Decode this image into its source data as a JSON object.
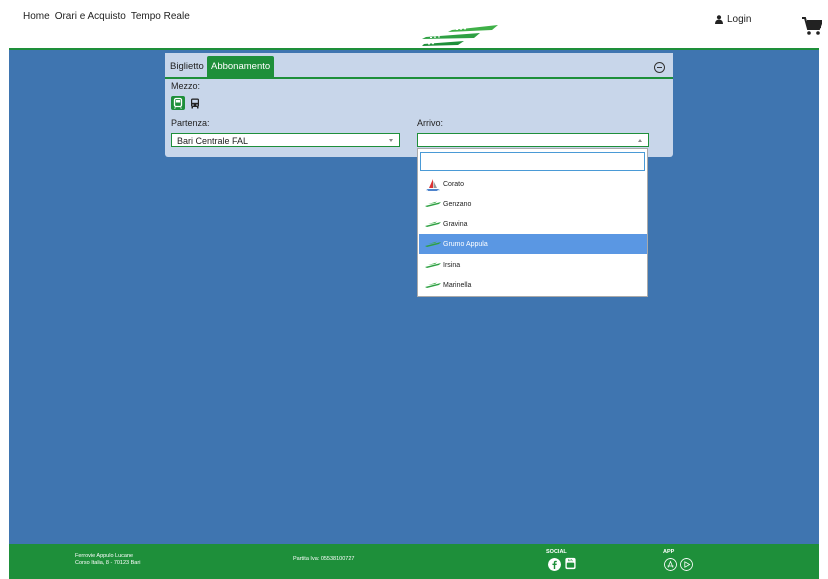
{
  "nav": {
    "items": [
      "Home",
      "Orari e Acquisto",
      "Tempo Reale"
    ],
    "login": "Login"
  },
  "tabs": [
    "Biglietto",
    "Abbonamento"
  ],
  "form": {
    "mezzo_label": "Mezzo:",
    "partenza_label": "Partenza:",
    "partenza_value": "Bari Centrale FAL",
    "arrivo_label": "Arrivo:",
    "arrivo_value": ""
  },
  "dropdown": {
    "search_value": "",
    "items": [
      {
        "label": "Corato",
        "icon": "ship-logo-icon"
      },
      {
        "label": "Genzano",
        "icon": "green-stripe-logo-icon"
      },
      {
        "label": "Gravina",
        "icon": "green-stripe-logo-icon"
      },
      {
        "label": "Grumo Appula",
        "icon": "green-stripe-logo-icon",
        "highlighted": true
      },
      {
        "label": "Irsina",
        "icon": "green-stripe-logo-icon"
      },
      {
        "label": "Marinella",
        "icon": "green-stripe-logo-icon"
      }
    ]
  },
  "footer": {
    "company": "Ferrovie Appulo Lucane",
    "address": "Corso Italia, 8 - 70123 Bari",
    "piva": "Partita Iva: 05538100727",
    "social_label": "SOCIAL",
    "app_label": "APP"
  },
  "colors": {
    "brand_green": "#1e8f3a",
    "main_blue": "#3f75b0",
    "panel_bg": "#c8d6ea",
    "highlight": "#5a97e3"
  }
}
